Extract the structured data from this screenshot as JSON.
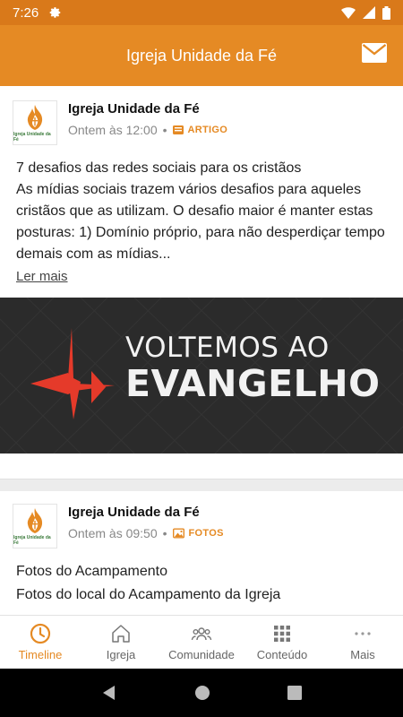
{
  "status_bar": {
    "time": "7:26"
  },
  "app_bar": {
    "title": "Igreja Unidade da Fé"
  },
  "logo": {
    "text": "Igreja Unidade da Fé"
  },
  "posts": [
    {
      "author": "Igreja Unidade da Fé",
      "time": "Ontem às 12:00",
      "separator": "•",
      "tag": "ARTIGO",
      "title": "7 desafios das redes sociais para os cristãos",
      "body": "As mídias sociais trazem vários desafios para aqueles cristãos que as utilizam. O desafio maior é manter estas posturas: 1) Domínio próprio, para não desperdiçar tempo demais com as mídias...",
      "read_more": "Ler mais",
      "banner": {
        "line1": "VOLTEMOS AO",
        "line2": "EVANGELHO"
      }
    },
    {
      "author": "Igreja Unidade da Fé",
      "time": "Ontem às 09:50",
      "separator": "•",
      "tag": "FOTOS",
      "title": "Fotos do Acampamento",
      "body": "Fotos do local do Acampamento da Igreja"
    }
  ],
  "bottom_nav": [
    {
      "label": "Timeline",
      "icon": "clock-icon",
      "active": true
    },
    {
      "label": "Igreja",
      "icon": "house-icon"
    },
    {
      "label": "Comunidade",
      "icon": "people-icon"
    },
    {
      "label": "Conteúdo",
      "icon": "grid-icon"
    },
    {
      "label": "Mais",
      "icon": "more-dots-icon"
    }
  ],
  "colors": {
    "primary": "#e58a24",
    "status_bar": "#d9791a",
    "banner_bg": "#2b2b2b",
    "cross_red": "#e53a2a"
  }
}
